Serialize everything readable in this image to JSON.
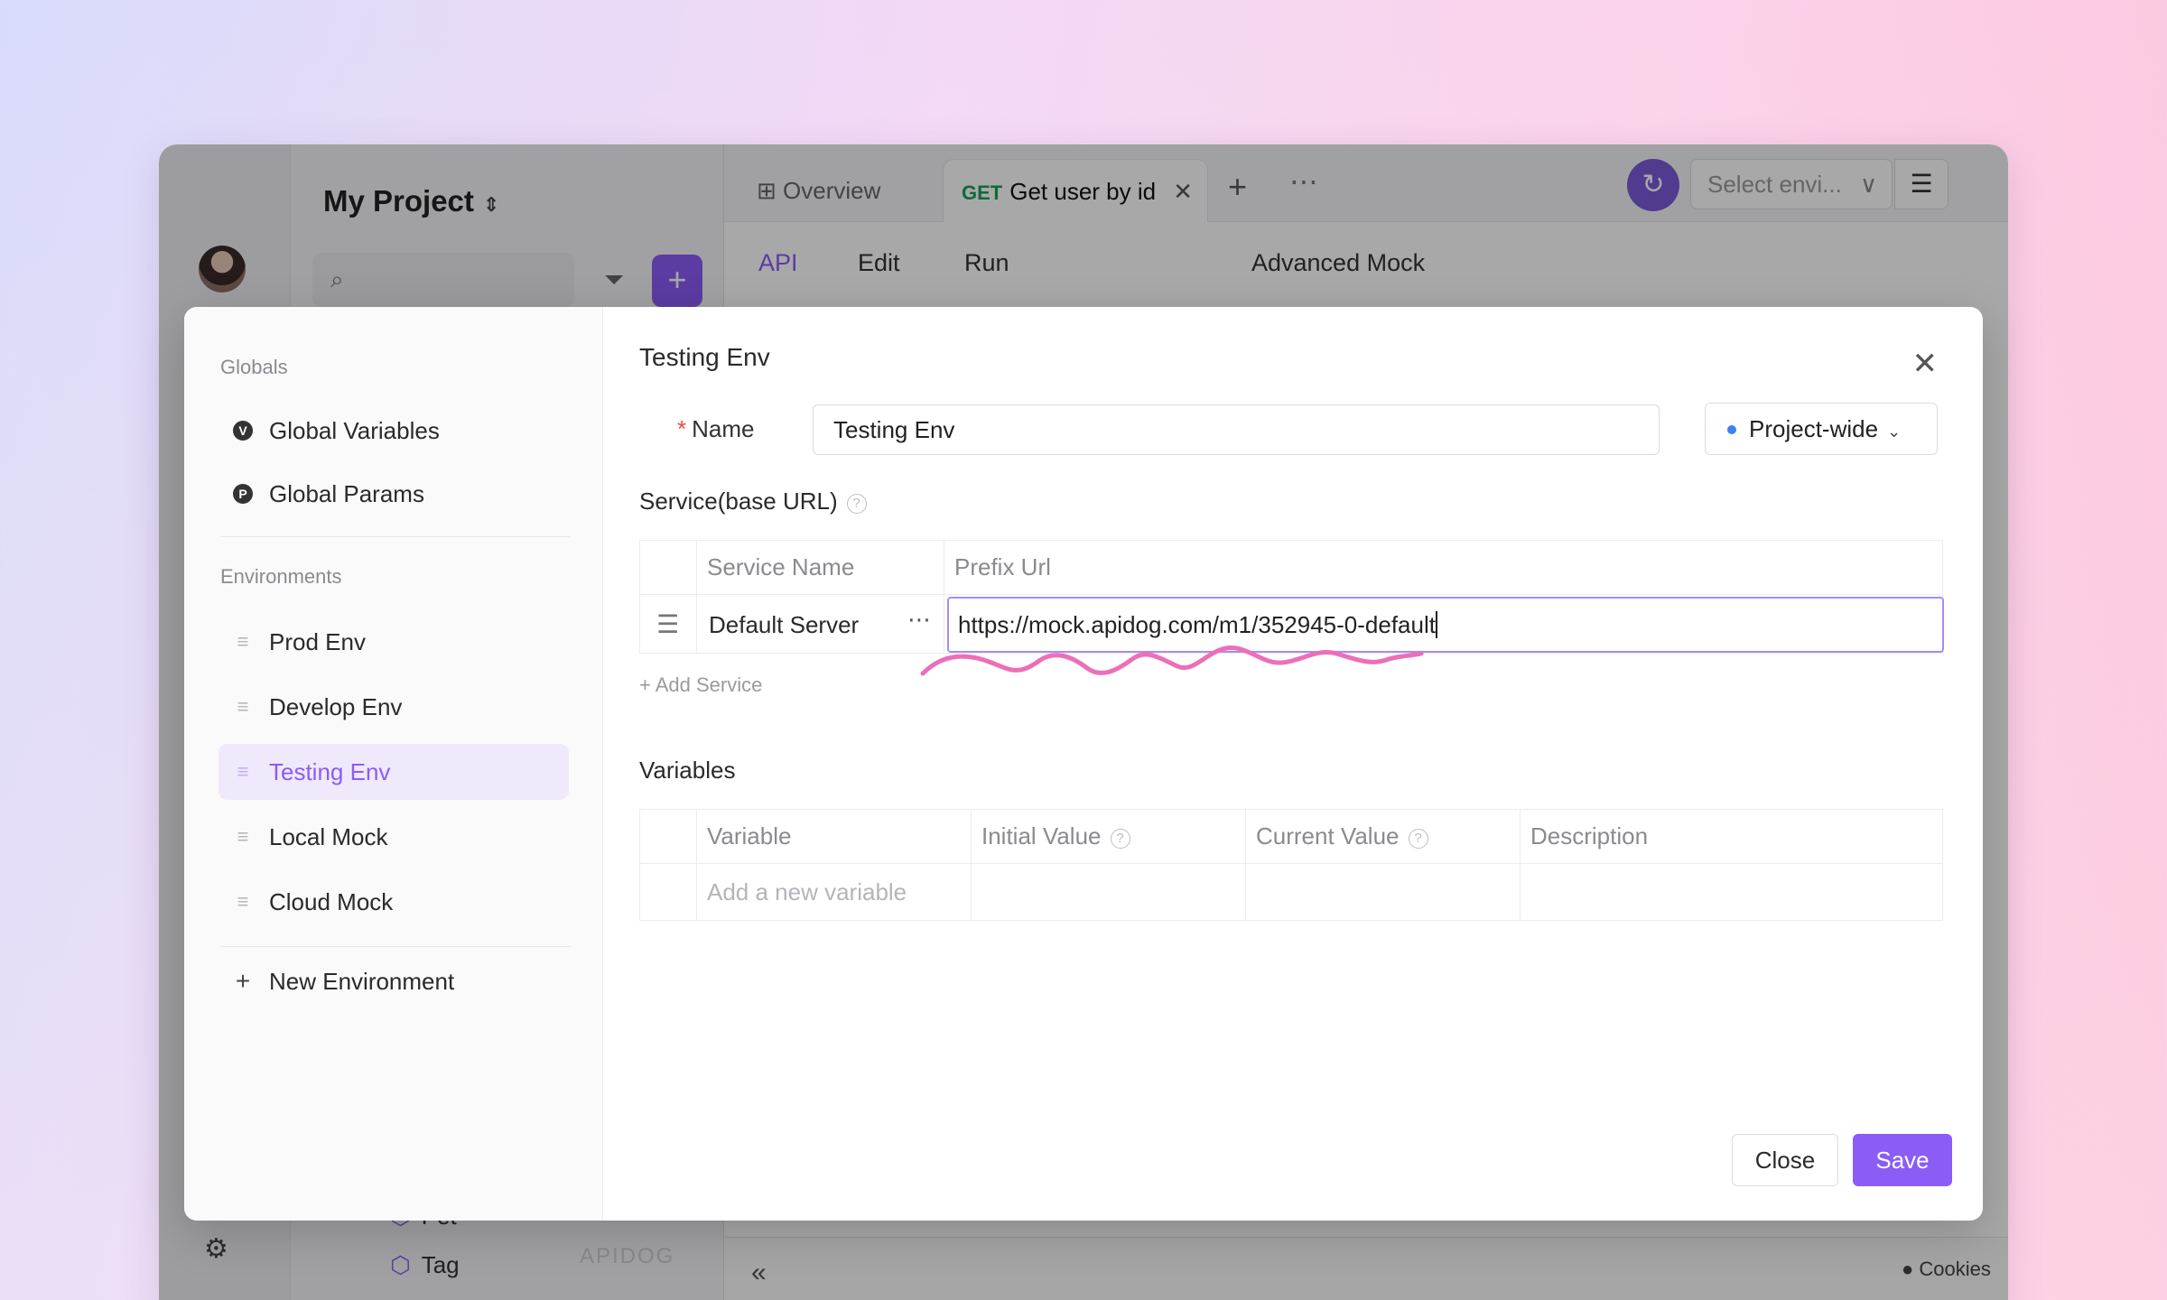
{
  "window": {
    "project_title": "My Project",
    "tabs": [
      {
        "label": "Overview"
      },
      {
        "method": "GET",
        "label": "Get user by id"
      }
    ],
    "env_select_placeholder": "Select envi...",
    "subtabs": [
      "API",
      "Edit",
      "Run",
      "Advanced Mock"
    ],
    "tree_items": [
      "Pet",
      "Tag"
    ],
    "watermark": "APIDOG",
    "footer": {
      "cookies": "Cookies"
    }
  },
  "modal": {
    "sidebar": {
      "globals_heading": "Globals",
      "globals": [
        {
          "label": "Global Variables",
          "badge": "V"
        },
        {
          "label": "Global Params",
          "badge": "P"
        }
      ],
      "environments_heading": "Environments",
      "environments": [
        {
          "label": "Prod Env",
          "active": false
        },
        {
          "label": "Develop Env",
          "active": false
        },
        {
          "label": "Testing Env",
          "active": true
        },
        {
          "label": "Local Mock",
          "active": false
        },
        {
          "label": "Cloud Mock",
          "active": false
        }
      ],
      "new_environment": "New Environment"
    },
    "title": "Testing Env",
    "name_label": "Name",
    "name_value": "Testing Env",
    "scope": "Project-wide",
    "service_section": "Service(base URL)",
    "service_table": {
      "headers": [
        "Service Name",
        "Prefix Url"
      ],
      "rows": [
        {
          "name": "Default Server",
          "prefix_url": "https://mock.apidog.com/m1/352945-0-default"
        }
      ]
    },
    "add_service": "Add Service",
    "variables_section": "Variables",
    "variables_table": {
      "headers": [
        "Variable",
        "Initial Value",
        "Current Value",
        "Description"
      ],
      "placeholder": "Add a new variable"
    },
    "buttons": {
      "close": "Close",
      "save": "Save"
    }
  },
  "colors": {
    "accent": "#8b5cf6",
    "get_method": "#18a058",
    "annotation": "#ec6fb8"
  }
}
